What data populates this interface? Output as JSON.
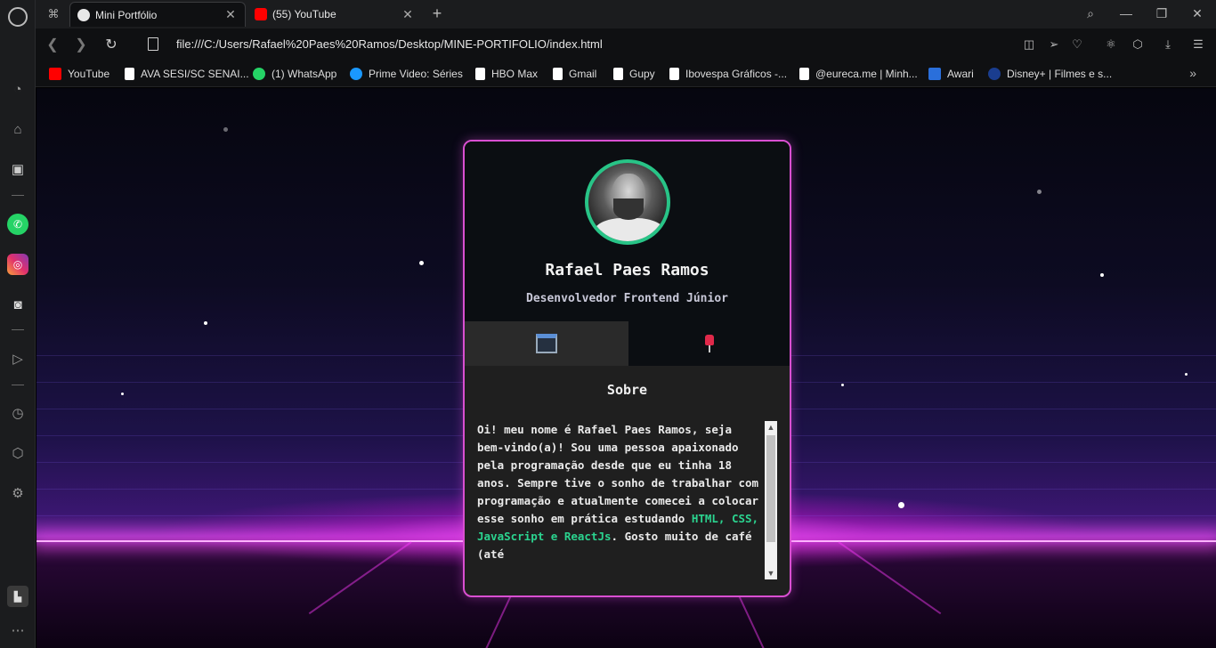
{
  "browser": {
    "tabs": [
      {
        "title": "Mini Portfólio",
        "active": true
      },
      {
        "title": "(55) YouTube",
        "active": false
      }
    ],
    "url": "file:///C:/Users/Rafael%20Paes%20Ramos/Desktop/MINE-PORTIFOLIO/index.html",
    "bookmarks": [
      {
        "label": "YouTube",
        "icon": "youtube-icon",
        "color": "#ff0000"
      },
      {
        "label": "AVA SESI/SC SENAI...",
        "icon": "page-icon",
        "color": "#ffffff"
      },
      {
        "label": "(1) WhatsApp",
        "icon": "whatsapp-icon",
        "color": "#25d366"
      },
      {
        "label": "Prime Video: Séries",
        "icon": "prime-icon",
        "color": "#1a98ff"
      },
      {
        "label": "HBO Max",
        "icon": "page-icon",
        "color": "#ffffff"
      },
      {
        "label": "Gmail",
        "icon": "page-icon",
        "color": "#ffffff"
      },
      {
        "label": "Gupy",
        "icon": "page-icon",
        "color": "#ffffff"
      },
      {
        "label": "Ibovespa Gráficos -...",
        "icon": "page-icon",
        "color": "#ffffff"
      },
      {
        "label": "@eureca.me | Minh...",
        "icon": "page-icon",
        "color": "#ffffff"
      },
      {
        "label": "Awari",
        "icon": "awari-icon",
        "color": "#2a6fdb"
      },
      {
        "label": "Disney+ | Filmes e s...",
        "icon": "disney-icon",
        "color": "#1a3d8f"
      }
    ]
  },
  "profile": {
    "name": "Rafael Paes Ramos",
    "role": "Desenvolvedor Frontend Júnior",
    "section_title": "Sobre",
    "about_part1": "Oi! meu nome é Rafael Paes Ramos, seja bem-vindo(a)! Sou uma pessoa apaixonado pela programação desde que eu tinha 18 anos. Sempre tive o sonho de trabalhar com programação e atualmente comecei a colocar esse sonho em prática estudando ",
    "about_highlight": "HTML, CSS, JavaScript e ReactJs",
    "about_part2": ". Gosto muito de café (até",
    "accent_color": "#28c487",
    "border_color": "#d94fd1"
  }
}
